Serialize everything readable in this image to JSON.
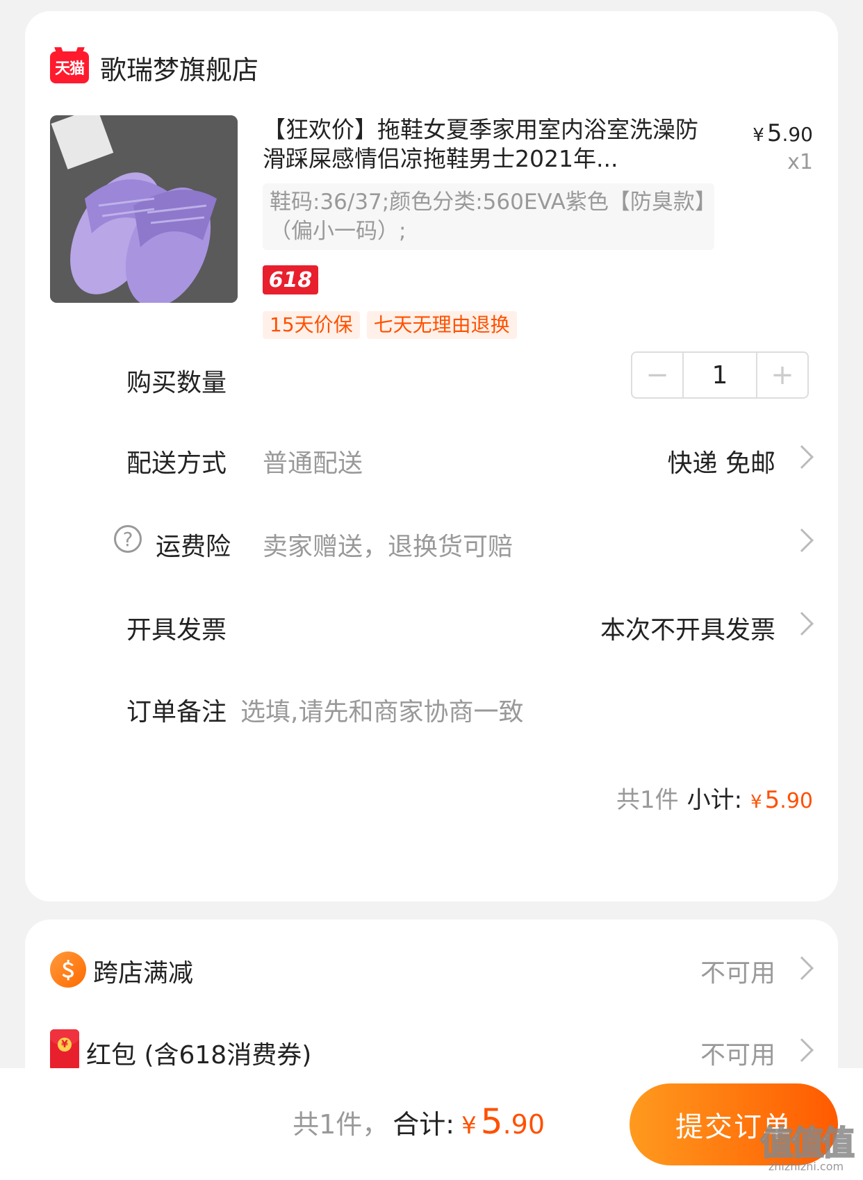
{
  "shop": {
    "platform_logo": "天猫",
    "name": "歌瑞梦旗舰店"
  },
  "product": {
    "title": "【狂欢价】拖鞋女夏季家用室内浴室洗澡防滑踩屎感情侣凉拖鞋男士2021年...",
    "price": {
      "symbol": "¥",
      "int": "5",
      "dec": ".90"
    },
    "qty_label": "x1",
    "sku_text": "鞋码:36/37;颜色分类:560EVA紫色【防臭款】（偏小一码）;",
    "promo_tag": "618",
    "service_tags": [
      "15天价保",
      "七天无理由退换"
    ]
  },
  "quantity": {
    "label": "购买数量",
    "minus": "−",
    "value": "1",
    "plus": "+"
  },
  "delivery": {
    "label": "配送方式",
    "desc": "普通配送",
    "value": "快递 免邮"
  },
  "shipping_insurance": {
    "help_icon": "?",
    "label": "运费险",
    "desc": "卖家赠送，退换货可赔"
  },
  "invoice": {
    "label": "开具发票",
    "value": "本次不开具发票"
  },
  "note": {
    "label": "订单备注",
    "placeholder": "选填,请先和商家协商一致"
  },
  "subtotal": {
    "count_text": "共1件",
    "label": "小计:",
    "symbol": "¥",
    "int": "5",
    "dec": ".90"
  },
  "discounts": [
    {
      "label": "跨店满减",
      "value": "不可用"
    },
    {
      "label": "红包 (含618消费券)",
      "value": "不可用"
    }
  ],
  "footer": {
    "count_text": "共1件，",
    "label": "合计:",
    "symbol": "¥",
    "int": "5",
    "dec": ".90",
    "submit_label": "提交订单"
  },
  "watermark": {
    "big": "值值值",
    "small": "zhizhizhi.com"
  },
  "colors": {
    "accent": "#ff5000",
    "tmall_red": "#e8202e",
    "background": "#f2f2f2"
  }
}
